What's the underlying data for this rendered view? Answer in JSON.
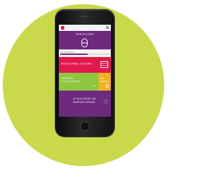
{
  "app": {
    "logo_icon": "app-logo-icon",
    "settings_icon": "gear-icon"
  },
  "pilulier": {
    "title": "MON PILULIER",
    "icon": "pill-icon",
    "color": "#6d2a7e"
  },
  "progress": {
    "label": "Prochaine prise",
    "value": 0.55
  },
  "journal": {
    "title": "MON JOURNAL DE BORD",
    "icon": "calendar-icon",
    "color": "#e2194b"
  },
  "conseils": {
    "title_line1": "CONSEILS",
    "title_line2": "D'UTILISATION",
    "icon": "plus-icon",
    "icon_glyph": "+",
    "color": "#8ec63f"
  },
  "rappel": {
    "title_line1": "UN",
    "title_line2": "RAPPEL",
    "icon": "clock-icon",
    "color": "#f2b01e"
  },
  "rapport": {
    "title_line1": "JE VAIS AVOIR UN",
    "title_line2": "RAPPORT SEXUEL",
    "icon": "heart-icon",
    "icon_glyph": "♡",
    "color": "#6d2a7e"
  },
  "background_color": "#cad94c"
}
